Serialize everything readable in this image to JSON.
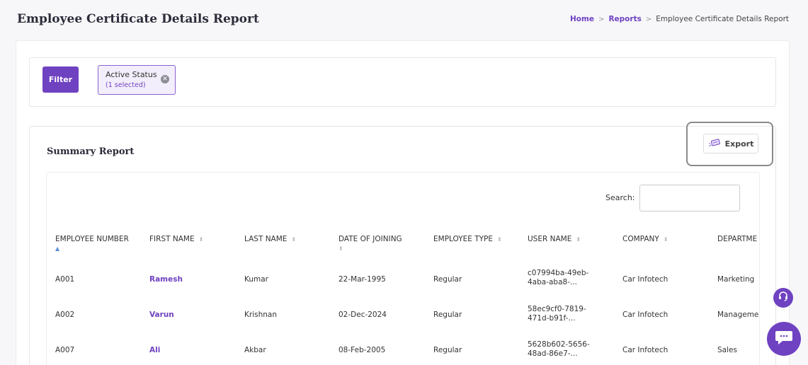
{
  "header": {
    "title": "Employee Certificate Details Report",
    "breadcrumb": {
      "home": "Home",
      "reports": "Reports",
      "current": "Employee Certificate Details Report",
      "sep": ">"
    }
  },
  "filter": {
    "button_label": "Filter",
    "chip": {
      "title": "Active Status",
      "subtitle": "(1 selected)"
    }
  },
  "report": {
    "title": "Summary Report",
    "export_label": "Export",
    "search_label": "Search:",
    "search_value": "",
    "columns": [
      "EMPLOYEE NUMBER",
      "FIRST NAME",
      "LAST NAME",
      "DATE OF JOINING",
      "EMPLOYEE TYPE",
      "USER NAME",
      "COMPANY",
      "DEPARTME"
    ],
    "rows": [
      {
        "emp_no": "A001",
        "first": "Ramesh",
        "last": "Kumar",
        "doj": "22-Mar-1995",
        "type": "Regular",
        "user1": "c07994ba-49eb-",
        "user2": "4aba-aba8-...",
        "company": "Car Infotech",
        "dept": "Marketing"
      },
      {
        "emp_no": "A002",
        "first": "Varun",
        "last": "Krishnan",
        "doj": "02-Dec-2024",
        "type": "Regular",
        "user1": "58ec9cf0-7819-",
        "user2": "471d-b91f-...",
        "company": "Car Infotech",
        "dept": "Manageme"
      },
      {
        "emp_no": "A007",
        "first": "Ali",
        "last": "Akbar",
        "doj": "08-Feb-2005",
        "type": "Regular",
        "user1": "5628b602-5656-",
        "user2": "48ad-86e7-...",
        "company": "Car Infotech",
        "dept": "Sales"
      }
    ]
  },
  "icons": {
    "close": "x-circle-icon",
    "export": "export-icon",
    "sort": "sort-icon",
    "help": "headset-icon",
    "chat": "chat-icon"
  },
  "colors": {
    "accent": "#6f42c1",
    "sort_active": "#5b8fd8"
  }
}
